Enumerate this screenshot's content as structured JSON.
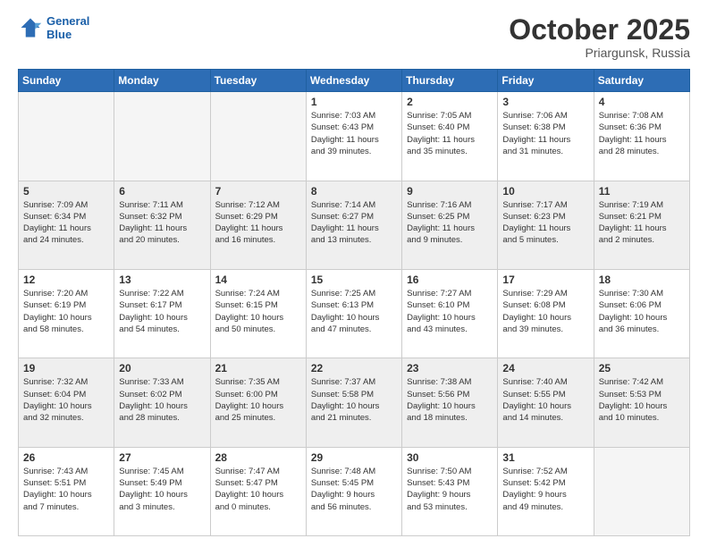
{
  "header": {
    "logo_line1": "General",
    "logo_line2": "Blue",
    "month": "October 2025",
    "location": "Priargunsk, Russia"
  },
  "weekdays": [
    "Sunday",
    "Monday",
    "Tuesday",
    "Wednesday",
    "Thursday",
    "Friday",
    "Saturday"
  ],
  "weeks": [
    {
      "shaded": false,
      "days": [
        {
          "date": "",
          "info": ""
        },
        {
          "date": "",
          "info": ""
        },
        {
          "date": "",
          "info": ""
        },
        {
          "date": "1",
          "info": "Sunrise: 7:03 AM\nSunset: 6:43 PM\nDaylight: 11 hours\nand 39 minutes."
        },
        {
          "date": "2",
          "info": "Sunrise: 7:05 AM\nSunset: 6:40 PM\nDaylight: 11 hours\nand 35 minutes."
        },
        {
          "date": "3",
          "info": "Sunrise: 7:06 AM\nSunset: 6:38 PM\nDaylight: 11 hours\nand 31 minutes."
        },
        {
          "date": "4",
          "info": "Sunrise: 7:08 AM\nSunset: 6:36 PM\nDaylight: 11 hours\nand 28 minutes."
        }
      ]
    },
    {
      "shaded": true,
      "days": [
        {
          "date": "5",
          "info": "Sunrise: 7:09 AM\nSunset: 6:34 PM\nDaylight: 11 hours\nand 24 minutes."
        },
        {
          "date": "6",
          "info": "Sunrise: 7:11 AM\nSunset: 6:32 PM\nDaylight: 11 hours\nand 20 minutes."
        },
        {
          "date": "7",
          "info": "Sunrise: 7:12 AM\nSunset: 6:29 PM\nDaylight: 11 hours\nand 16 minutes."
        },
        {
          "date": "8",
          "info": "Sunrise: 7:14 AM\nSunset: 6:27 PM\nDaylight: 11 hours\nand 13 minutes."
        },
        {
          "date": "9",
          "info": "Sunrise: 7:16 AM\nSunset: 6:25 PM\nDaylight: 11 hours\nand 9 minutes."
        },
        {
          "date": "10",
          "info": "Sunrise: 7:17 AM\nSunset: 6:23 PM\nDaylight: 11 hours\nand 5 minutes."
        },
        {
          "date": "11",
          "info": "Sunrise: 7:19 AM\nSunset: 6:21 PM\nDaylight: 11 hours\nand 2 minutes."
        }
      ]
    },
    {
      "shaded": false,
      "days": [
        {
          "date": "12",
          "info": "Sunrise: 7:20 AM\nSunset: 6:19 PM\nDaylight: 10 hours\nand 58 minutes."
        },
        {
          "date": "13",
          "info": "Sunrise: 7:22 AM\nSunset: 6:17 PM\nDaylight: 10 hours\nand 54 minutes."
        },
        {
          "date": "14",
          "info": "Sunrise: 7:24 AM\nSunset: 6:15 PM\nDaylight: 10 hours\nand 50 minutes."
        },
        {
          "date": "15",
          "info": "Sunrise: 7:25 AM\nSunset: 6:13 PM\nDaylight: 10 hours\nand 47 minutes."
        },
        {
          "date": "16",
          "info": "Sunrise: 7:27 AM\nSunset: 6:10 PM\nDaylight: 10 hours\nand 43 minutes."
        },
        {
          "date": "17",
          "info": "Sunrise: 7:29 AM\nSunset: 6:08 PM\nDaylight: 10 hours\nand 39 minutes."
        },
        {
          "date": "18",
          "info": "Sunrise: 7:30 AM\nSunset: 6:06 PM\nDaylight: 10 hours\nand 36 minutes."
        }
      ]
    },
    {
      "shaded": true,
      "days": [
        {
          "date": "19",
          "info": "Sunrise: 7:32 AM\nSunset: 6:04 PM\nDaylight: 10 hours\nand 32 minutes."
        },
        {
          "date": "20",
          "info": "Sunrise: 7:33 AM\nSunset: 6:02 PM\nDaylight: 10 hours\nand 28 minutes."
        },
        {
          "date": "21",
          "info": "Sunrise: 7:35 AM\nSunset: 6:00 PM\nDaylight: 10 hours\nand 25 minutes."
        },
        {
          "date": "22",
          "info": "Sunrise: 7:37 AM\nSunset: 5:58 PM\nDaylight: 10 hours\nand 21 minutes."
        },
        {
          "date": "23",
          "info": "Sunrise: 7:38 AM\nSunset: 5:56 PM\nDaylight: 10 hours\nand 18 minutes."
        },
        {
          "date": "24",
          "info": "Sunrise: 7:40 AM\nSunset: 5:55 PM\nDaylight: 10 hours\nand 14 minutes."
        },
        {
          "date": "25",
          "info": "Sunrise: 7:42 AM\nSunset: 5:53 PM\nDaylight: 10 hours\nand 10 minutes."
        }
      ]
    },
    {
      "shaded": false,
      "days": [
        {
          "date": "26",
          "info": "Sunrise: 7:43 AM\nSunset: 5:51 PM\nDaylight: 10 hours\nand 7 minutes."
        },
        {
          "date": "27",
          "info": "Sunrise: 7:45 AM\nSunset: 5:49 PM\nDaylight: 10 hours\nand 3 minutes."
        },
        {
          "date": "28",
          "info": "Sunrise: 7:47 AM\nSunset: 5:47 PM\nDaylight: 10 hours\nand 0 minutes."
        },
        {
          "date": "29",
          "info": "Sunrise: 7:48 AM\nSunset: 5:45 PM\nDaylight: 9 hours\nand 56 minutes."
        },
        {
          "date": "30",
          "info": "Sunrise: 7:50 AM\nSunset: 5:43 PM\nDaylight: 9 hours\nand 53 minutes."
        },
        {
          "date": "31",
          "info": "Sunrise: 7:52 AM\nSunset: 5:42 PM\nDaylight: 9 hours\nand 49 minutes."
        },
        {
          "date": "",
          "info": ""
        }
      ]
    }
  ]
}
